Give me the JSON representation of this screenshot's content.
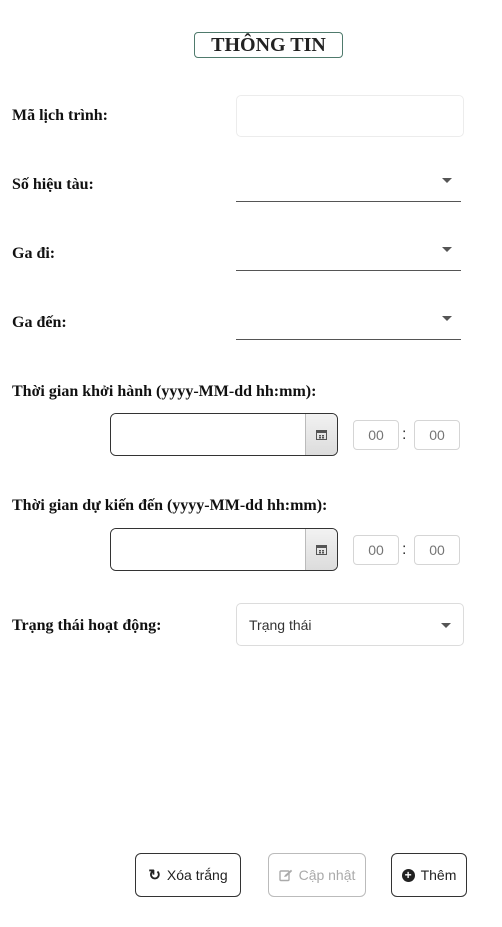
{
  "form": {
    "title": "THÔNG TIN",
    "route_code": {
      "label": "Mã lịch trình:",
      "value": ""
    },
    "train_number": {
      "label": "Số hiệu tàu:",
      "value": ""
    },
    "departure_station": {
      "label": "Ga đi:",
      "value": ""
    },
    "arrival_station": {
      "label": "Ga đến:",
      "value": ""
    },
    "departure_time": {
      "label": "Thời gian khởi hành (yyyy-MM-dd hh:mm):",
      "date_value": "",
      "hour_placeholder": "00",
      "minute_placeholder": "00",
      "separator": ":"
    },
    "arrival_time": {
      "label": "Thời gian dự kiến đến (yyyy-MM-dd hh:mm):",
      "date_value": "",
      "hour_placeholder": "00",
      "minute_placeholder": "00",
      "separator": ":"
    },
    "status": {
      "label": "Trạng thái hoạt động:",
      "selected": "Trạng thái"
    }
  },
  "buttons": {
    "clear_label": "Xóa trắng",
    "update_label": "Cập nhật",
    "add_label": "Thêm"
  },
  "icons": {
    "calendar": "calendar-icon",
    "refresh": "refresh-icon",
    "edit": "edit-icon",
    "add": "plus-circle-icon"
  }
}
